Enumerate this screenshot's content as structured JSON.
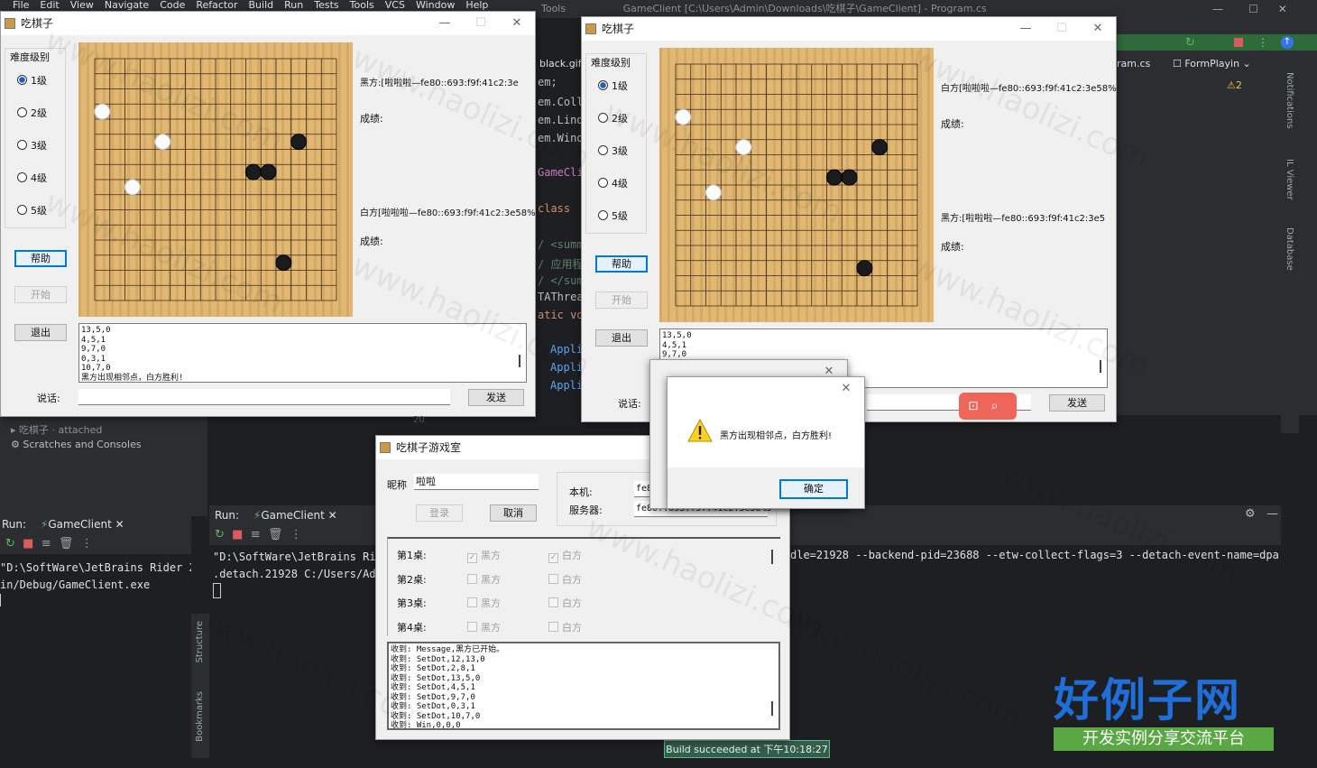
{
  "ide": {
    "menu": [
      "File",
      "Edit",
      "View",
      "Navigate",
      "Code",
      "Refactor",
      "Build",
      "Run",
      "Tests",
      "Tools",
      "VCS",
      "Window",
      "Help"
    ],
    "path_title": "GameClient [C:\\Users\\Admin\\Downloads\\吃棋子\\GameClient] - Program.cs",
    "tools_label": "Tools",
    "tabs": {
      "black_gif": "black.gif",
      "program_cs": "ram.cs",
      "form_playing": "FormPlayin"
    },
    "warnings": "2",
    "right_strip": [
      "Notifications",
      "IL Viewer",
      "Database"
    ],
    "left_strip": [
      "Structure",
      "Bookmarks"
    ],
    "editor_lines": [
      "em;",
      "em.Coll",
      "em.Lind",
      "em.Wind",
      "GameCli",
      "class",
      "/ <summ",
      "/ 应用程",
      "/ </sum",
      "TAThrea",
      "atic vo",
      "Appli",
      "Appli",
      "Appli"
    ],
    "line_number": "20",
    "tree": {
      "attached": "吃棋子 · attached",
      "scratches": "Scratches and Consoles"
    },
    "run_left": {
      "label": "Run:",
      "tab": "GameClient",
      "lines": [
        "\"D:\\SoftWare\\JetBrains Rider 2",
        "in/Debug/GameClient.exe"
      ]
    },
    "run_main": {
      "label": "Run:",
      "tab": "GameClient",
      "lines": [
        "\"D:\\SoftWare\\JetBrains Rid",
        ".detach.21928 C:/Users/Adm"
      ],
      "right_line": "dle=21928 --backend-pid=23688 --etw-collect-flags=3 --detach-event-name=dpa"
    },
    "build_status": "Build succeeded at 下午10:18:27"
  },
  "game_window_left": {
    "title": "吃棋子",
    "difficulty_label": "难度级别",
    "levels": [
      "1级",
      "2级",
      "3级",
      "4级",
      "5级"
    ],
    "selected_level": "1级",
    "buttons": {
      "help": "帮助",
      "start": "开始",
      "exit": "退出",
      "send": "发送"
    },
    "player_top": "黑方:[啦啦啦—fe80::693:f9f:41c2:3e",
    "player_bottom": "白方[啦啦啦—fe80::693:f9f:41c2:3e58%5",
    "score_label": "成绩:",
    "talk_label": "说话:",
    "log": "13,5,0\n4,5,1\n9,7,0\n0,3,1\n10,7,0\n黑方出现相邻点，白方胜利!"
  },
  "game_window_right": {
    "title": "吃棋子",
    "difficulty_label": "难度级别",
    "levels": [
      "1级",
      "2级",
      "3级",
      "4级",
      "5级"
    ],
    "selected_level": "1级",
    "buttons": {
      "help": "帮助",
      "start": "开始",
      "exit": "退出",
      "send": "发送"
    },
    "player_top": "白方[啦啦啦—fe80::693:f9f:41c2:3e58%5:",
    "player_bottom": "黑方:[啦啦啦—fe80::693:f9f:41c2:3e5",
    "score_label": "成绩:",
    "talk_label": "说话:",
    "log": "13,5,0\n4,5,1\n9,7,0"
  },
  "board": {
    "size": 16,
    "stones": [
      {
        "color": "white",
        "col": 0,
        "row": 3
      },
      {
        "color": "white",
        "col": 4,
        "row": 5
      },
      {
        "color": "white",
        "col": 2,
        "row": 8
      },
      {
        "color": "black",
        "col": 13,
        "row": 5
      },
      {
        "color": "black",
        "col": 10,
        "row": 7
      },
      {
        "color": "black",
        "col": 11,
        "row": 7
      },
      {
        "color": "black",
        "col": 12,
        "row": 13
      }
    ]
  },
  "lobby": {
    "title": "吃棋子游戏室",
    "nickname_label": "昵称",
    "nickname_value": "啦啦",
    "login": "登录",
    "cancel": "取消",
    "local_label": "本机:",
    "local_value": "fe8",
    "server_label": "服务器:",
    "server_value": "fe80::693:f9f:41c2:3e58%5",
    "tables": [
      {
        "label": "第1桌:",
        "black": "黑方",
        "white": "白方",
        "black_checked": true,
        "white_checked": true
      },
      {
        "label": "第2桌:",
        "black": "黑方",
        "white": "白方",
        "black_checked": false,
        "white_checked": false
      },
      {
        "label": "第3桌:",
        "black": "黑方",
        "white": "白方",
        "black_checked": false,
        "white_checked": false
      },
      {
        "label": "第4桌:",
        "black": "黑方",
        "white": "白方",
        "black_checked": false,
        "white_checked": false
      }
    ],
    "log": "收到: Message,黑方已开始。\n收到: SetDot,12,13,0\n收到: SetDot,2,8,1\n收到: SetDot,13,5,0\n收到: SetDot,4,5,1\n收到: SetDot,9,7,0\n收到: SetDot,0,3,1\n收到: SetDot,10,7,0\n收到: Win,0,0,0"
  },
  "dialog": {
    "message": "黑方出现相邻点，白方胜利!",
    "ok": "确定"
  },
  "watermark": "www.haolizi.com",
  "logo": {
    "main": "好例子网",
    "sub": "开发实例分享交流平台"
  }
}
